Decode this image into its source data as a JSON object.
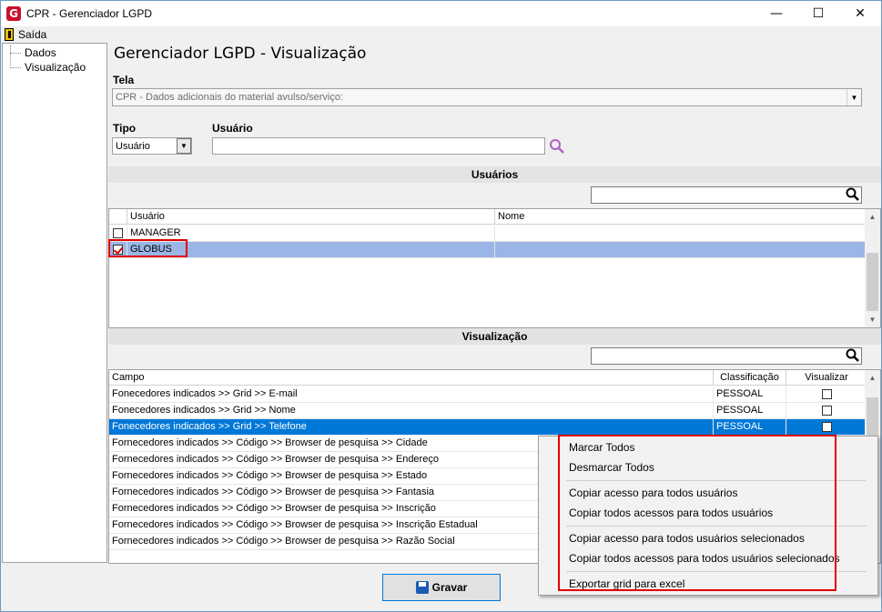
{
  "window": {
    "title": "CPR - Gerenciador LGPD",
    "minimize": "—",
    "maximize": "☐",
    "close": "✕"
  },
  "menu": {
    "exit_label": "Saída"
  },
  "sidebar": {
    "items": [
      {
        "label": "Dados"
      },
      {
        "label": "Visualização"
      }
    ]
  },
  "page": {
    "title": "Gerenciador LGPD - Visualização",
    "tela_label": "Tela",
    "tela_value": "CPR - Dados adicionais do material avulso/serviço:",
    "tipo_label": "Tipo",
    "tipo_value": "Usuário",
    "usuario_label": "Usuário",
    "usuario_value": ""
  },
  "users_section": {
    "header": "Usuários",
    "search_value": "",
    "columns": [
      "Usuário",
      "Nome"
    ],
    "rows": [
      {
        "user": "MANAGER",
        "name": "",
        "checked": false
      },
      {
        "user": "GLOBUS",
        "name": "",
        "checked": true
      }
    ]
  },
  "view_section": {
    "header": "Visualização",
    "search_value": "",
    "columns": [
      "Campo",
      "Classificação",
      "Visualizar"
    ],
    "rows": [
      {
        "campo": "Fonecedores indicados >> Grid >> E-mail",
        "classificacao": "PESSOAL"
      },
      {
        "campo": "Fonecedores indicados >> Grid >> Nome",
        "classificacao": "PESSOAL"
      },
      {
        "campo": "Fonecedores indicados >> Grid >> Telefone",
        "classificacao": "PESSOAL"
      },
      {
        "campo": "Fornecedores indicados >> Código >> Browser de pesquisa >> Cidade",
        "classificacao": ""
      },
      {
        "campo": "Fornecedores indicados >> Código >> Browser de pesquisa >> Endereço",
        "classificacao": ""
      },
      {
        "campo": "Fornecedores indicados >> Código >> Browser de pesquisa >> Estado",
        "classificacao": ""
      },
      {
        "campo": "Fornecedores indicados >> Código >> Browser de pesquisa >> Fantasia",
        "classificacao": ""
      },
      {
        "campo": "Fornecedores indicados >> Código >> Browser de pesquisa >> Inscrição",
        "classificacao": ""
      },
      {
        "campo": "Fornecedores indicados >> Código >> Browser de pesquisa >> Inscrição Estadual",
        "classificacao": ""
      },
      {
        "campo": "Fornecedores indicados >> Código >> Browser de pesquisa >> Razão Social",
        "classificacao": ""
      }
    ]
  },
  "context_menu": {
    "items": [
      "Marcar Todos",
      "Desmarcar Todos",
      "Copiar acesso para todos usuários",
      "Copiar todos acessos para todos usuários",
      "Copiar acesso para todos usuários selecionados",
      "Copiar todos acessos para todos usuários selecionados",
      "Exportar grid para excel"
    ]
  },
  "footer": {
    "save_label": "Gravar"
  },
  "colors": {
    "selection": "#0078d7",
    "highlight_box": "#e00000",
    "search_icon": "#b05fc8"
  }
}
